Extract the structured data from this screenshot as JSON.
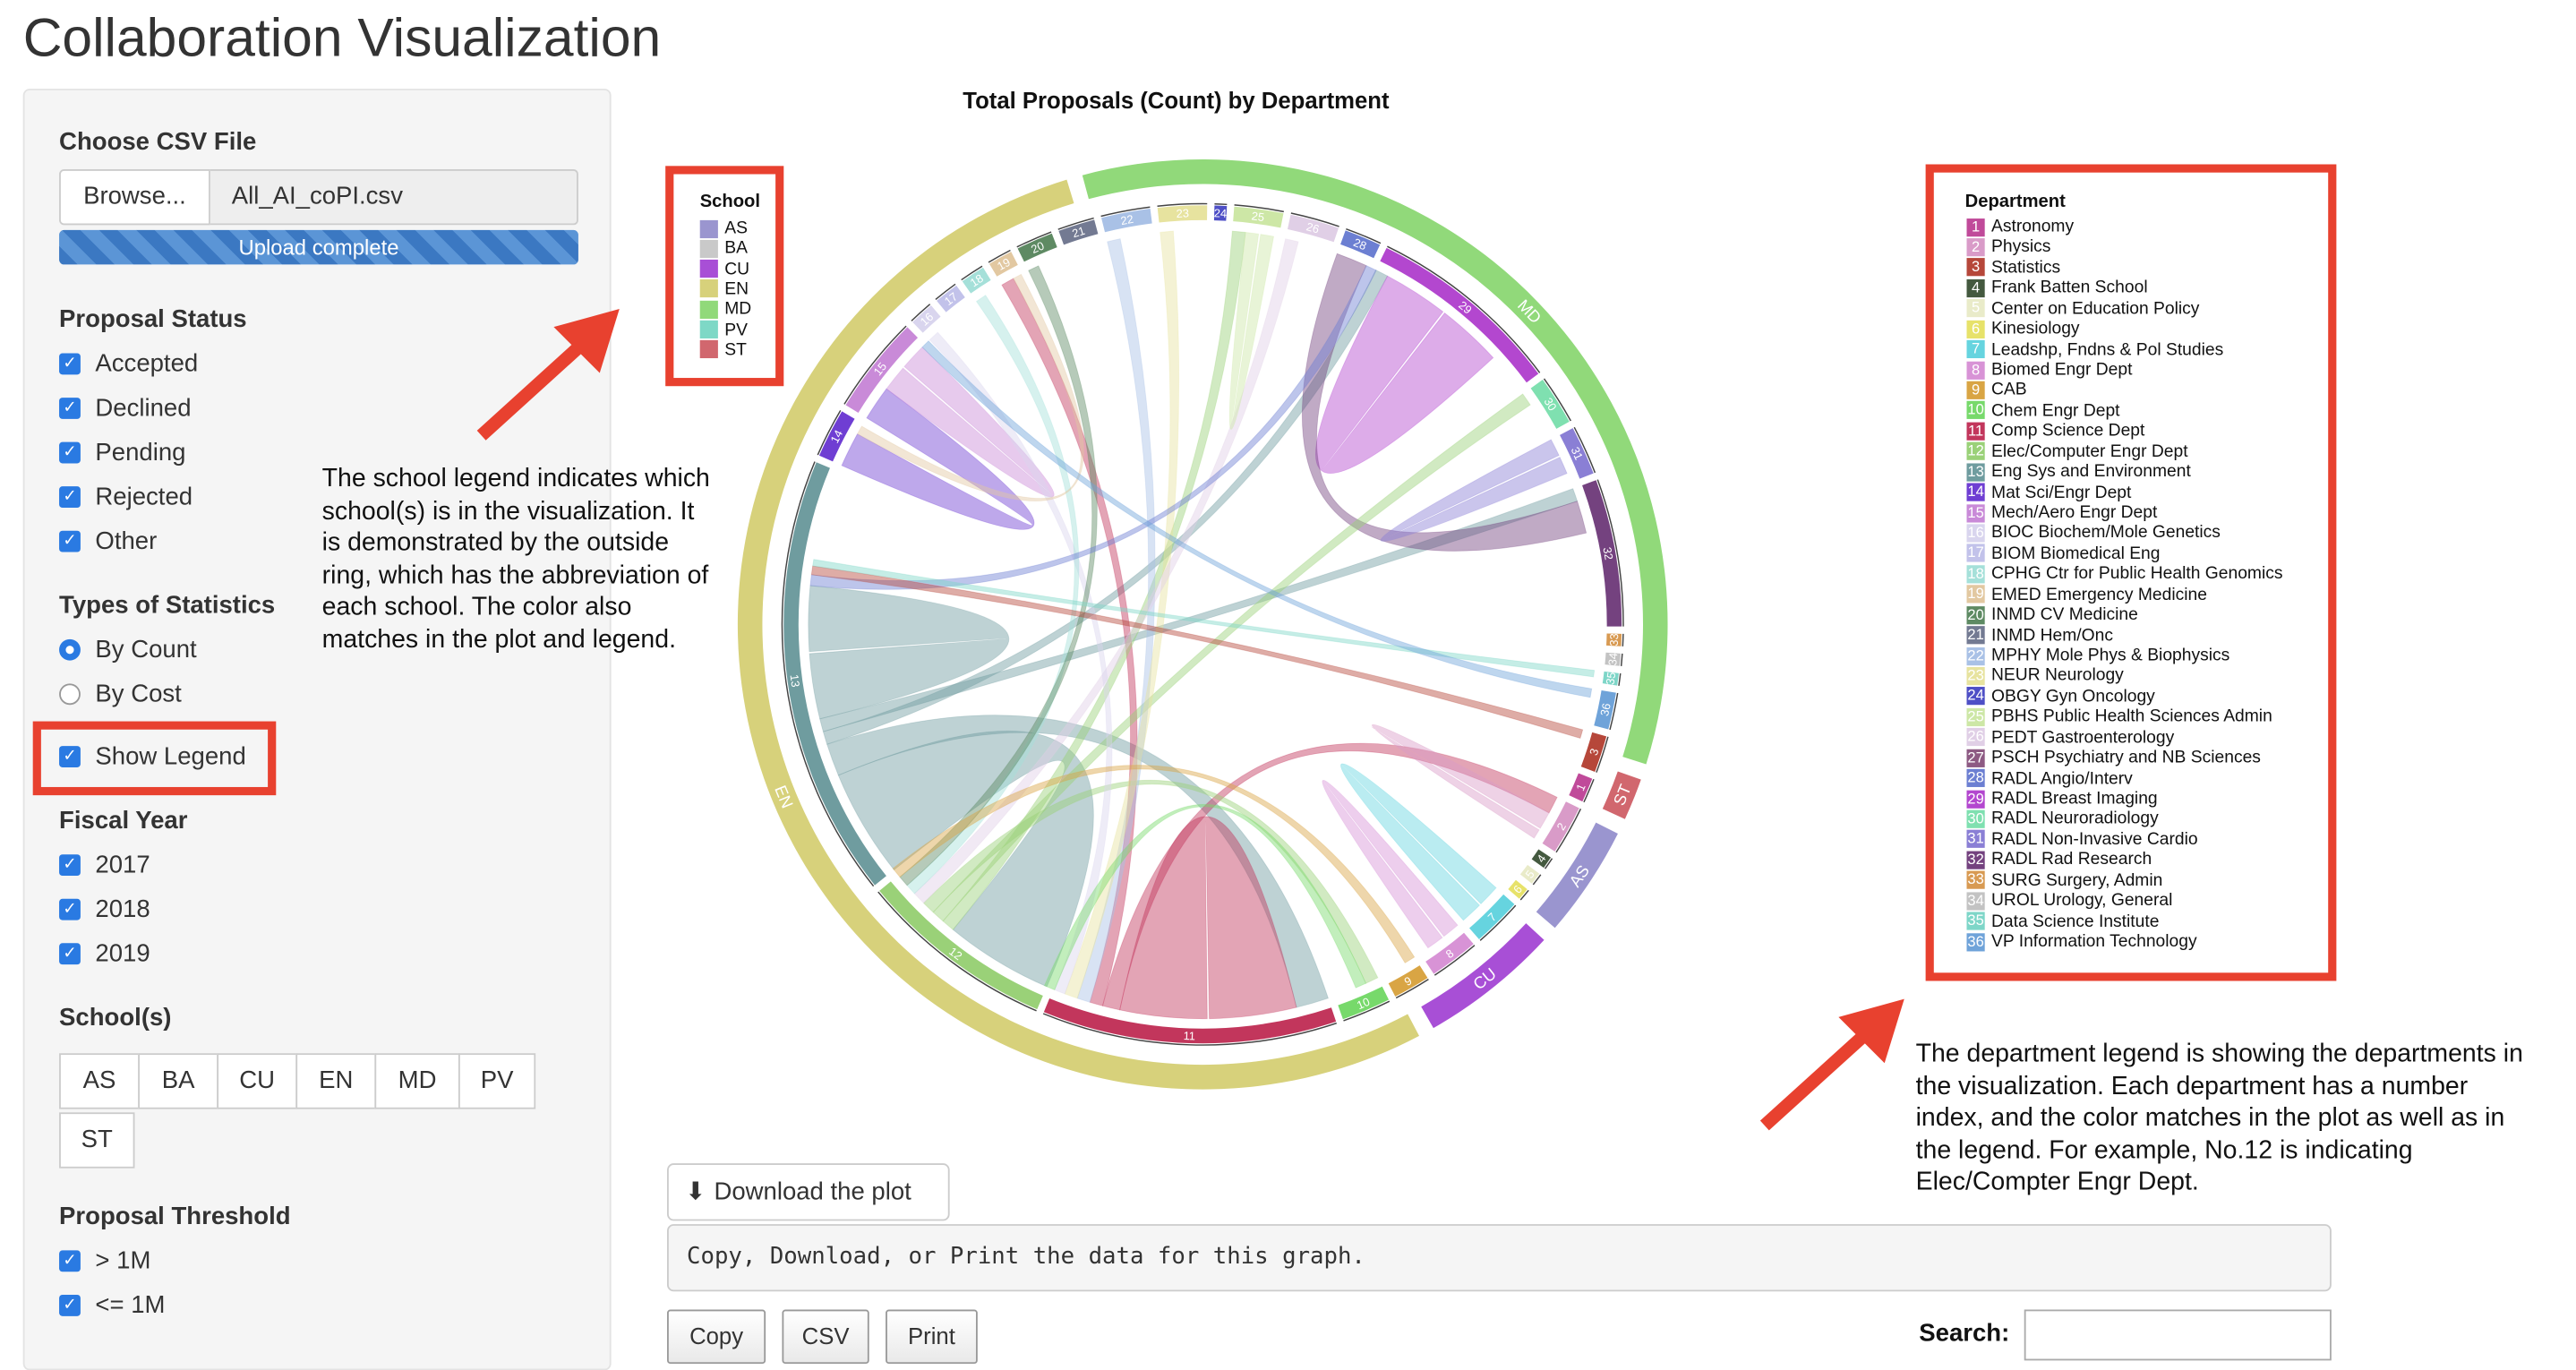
{
  "app": {
    "title": "Collaboration Visualization"
  },
  "sidebar": {
    "csv": {
      "label": "Choose CSV File",
      "browse": "Browse...",
      "file_name": "All_AI_coPI.csv",
      "progress": "Upload complete",
      "progress_pct": 100
    },
    "proposal_status": {
      "label": "Proposal Status",
      "options": [
        {
          "label": "Accepted",
          "checked": true
        },
        {
          "label": "Declined",
          "checked": true
        },
        {
          "label": "Pending",
          "checked": true
        },
        {
          "label": "Rejected",
          "checked": true
        },
        {
          "label": "Other",
          "checked": true
        }
      ]
    },
    "stat_types": {
      "label": "Types of Statistics",
      "options": [
        {
          "label": "By Count",
          "selected": true
        },
        {
          "label": "By Cost",
          "selected": false
        }
      ]
    },
    "show_legend": {
      "label": "Show Legend",
      "checked": true
    },
    "fiscal_year": {
      "label": "Fiscal Year",
      "options": [
        {
          "label": "2017",
          "checked": true
        },
        {
          "label": "2018",
          "checked": true
        },
        {
          "label": "2019",
          "checked": true
        }
      ]
    },
    "schools": {
      "label": "School(s)",
      "buttons": [
        "AS",
        "BA",
        "CU",
        "EN",
        "MD",
        "PV",
        "ST"
      ]
    },
    "threshold": {
      "label": "Proposal Threshold",
      "options": [
        {
          "label": "> 1M",
          "checked": true
        },
        {
          "label": "<= 1M",
          "checked": true
        }
      ]
    }
  },
  "chart_data": {
    "type": "chord",
    "title": "Total Proposals (Count) by Department",
    "school_legend": {
      "title": "School",
      "items": [
        {
          "code": "AS",
          "color": "#9a95cf"
        },
        {
          "code": "BA",
          "color": "#c9c9c9"
        },
        {
          "code": "CU",
          "color": "#a84fd6"
        },
        {
          "code": "EN",
          "color": "#d7d17b"
        },
        {
          "code": "MD",
          "color": "#91d97a"
        },
        {
          "code": "PV",
          "color": "#7ed8c6"
        },
        {
          "code": "ST",
          "color": "#d1676e"
        }
      ]
    },
    "department_legend": {
      "title": "Department",
      "items": [
        {
          "index": "1",
          "name": "Astronomy",
          "color": "#c04a9a"
        },
        {
          "index": "2",
          "name": "Physics",
          "color": "#d99bc8"
        },
        {
          "index": "3",
          "name": "Statistics",
          "color": "#b6473a"
        },
        {
          "index": "4",
          "name": "Frank Batten School",
          "color": "#44593f"
        },
        {
          "index": "5",
          "name": "Center on Education Policy",
          "color": "#e9ebc9"
        },
        {
          "index": "6",
          "name": "Kinesiology",
          "color": "#e7e26a"
        },
        {
          "index": "7",
          "name": "Leadshp, Fndns & Pol Studies",
          "color": "#66d4df"
        },
        {
          "index": "8",
          "name": "Biomed Engr Dept",
          "color": "#d893d6"
        },
        {
          "index": "9",
          "name": "CAB",
          "color": "#d9a544"
        },
        {
          "index": "10",
          "name": "Chem Engr Dept",
          "color": "#77d96b"
        },
        {
          "index": "11",
          "name": "Comp Science Dept",
          "color": "#c2365c"
        },
        {
          "index": "12",
          "name": "Elec/Computer Engr Dept",
          "color": "#9ad178"
        },
        {
          "index": "13",
          "name": "Eng Sys and Environment",
          "color": "#6f9c9f"
        },
        {
          "index": "14",
          "name": "Mat Sci/Engr Dept",
          "color": "#6f3ed3"
        },
        {
          "index": "15",
          "name": "Mech/Aero Engr Dept",
          "color": "#c98ad8"
        },
        {
          "index": "16",
          "name": "BIOC Biochem/Mole Genetics",
          "color": "#d9d5ee"
        },
        {
          "index": "17",
          "name": "BIOM Biomedical Eng",
          "color": "#c2c2ea"
        },
        {
          "index": "18",
          "name": "CPHG Ctr for Public Health Genomics",
          "color": "#a5e0d9"
        },
        {
          "index": "19",
          "name": "EMED Emergency Medicine",
          "color": "#e2c8a1"
        },
        {
          "index": "20",
          "name": "INMD CV Medicine",
          "color": "#5e8a63"
        },
        {
          "index": "21",
          "name": "INMD Hem/Onc",
          "color": "#737a92"
        },
        {
          "index": "22",
          "name": "MPHY Mole Phys & Biophysics",
          "color": "#a9c1e6"
        },
        {
          "index": "23",
          "name": "NEUR Neurology",
          "color": "#e7e39f"
        },
        {
          "index": "24",
          "name": "OBGY Gyn Oncology",
          "color": "#4e4fc6"
        },
        {
          "index": "25",
          "name": "PBHS Public Health Sciences Admin",
          "color": "#cde7a6"
        },
        {
          "index": "26",
          "name": "PEDT Gastroenterology",
          "color": "#e0cfe6"
        },
        {
          "index": "27",
          "name": "PSCH Psychiatry and NB Sciences",
          "color": "#8d5a83"
        },
        {
          "index": "28",
          "name": "RADL Angio/Interv",
          "color": "#6c7fd2"
        },
        {
          "index": "29",
          "name": "RADL Breast Imaging",
          "color": "#b347cf"
        },
        {
          "index": "30",
          "name": "RADL Neuroradiology",
          "color": "#7fe0b0"
        },
        {
          "index": "31",
          "name": "RADL Non-Invasive Cardio",
          "color": "#8a7fd5"
        },
        {
          "index": "32",
          "name": "RADL Rad Research",
          "color": "#74427f"
        },
        {
          "index": "33",
          "name": "SURG Surgery, Admin",
          "color": "#d89a52"
        },
        {
          "index": "34",
          "name": "UROL Urology, General",
          "color": "#c3c3c3"
        },
        {
          "index": "35",
          "name": "Data Science Institute",
          "color": "#7ed6c8"
        },
        {
          "index": "36",
          "name": "VP Information Technology",
          "color": "#6fa3d9"
        }
      ]
    },
    "outer_ring": [
      {
        "school": "MD",
        "color": "#91d97a",
        "value": 35
      },
      {
        "school": "ST",
        "color": "#d1676e",
        "value": 1.5
      },
      {
        "school": "AS",
        "color": "#9a95cf",
        "value": 4
      },
      {
        "school": "CU",
        "color": "#a84fd6",
        "value": 5
      },
      {
        "school": "EN",
        "color": "#d7d17b",
        "value": 54.5
      }
    ],
    "departments": [
      {
        "index": "22",
        "color": "#a9c1e6",
        "value": 2
      },
      {
        "index": "23",
        "color": "#e7e39f",
        "value": 2
      },
      {
        "index": "24",
        "color": "#4e4fc6",
        "value": 0.5
      },
      {
        "index": "25",
        "color": "#cde7a6",
        "value": 2
      },
      {
        "index": "26",
        "color": "#e0cfe6",
        "value": 2
      },
      {
        "index": "28",
        "color": "#6c7fd2",
        "value": 1.5
      },
      {
        "index": "29",
        "color": "#b347cf",
        "value": 8
      },
      {
        "index": "30",
        "color": "#7fe0b0",
        "value": 2
      },
      {
        "index": "31",
        "color": "#8a7fd5",
        "value": 2
      },
      {
        "index": "32",
        "color": "#74427f",
        "value": 6
      },
      {
        "index": "33",
        "color": "#d89a52",
        "value": 0.5
      },
      {
        "index": "34",
        "color": "#c3c3c3",
        "value": 0.5
      },
      {
        "index": "35",
        "color": "#7ed6c8",
        "value": 0.5
      },
      {
        "index": "36",
        "color": "#6fa3d9",
        "value": 1.5
      },
      {
        "index": "3",
        "color": "#b6473a",
        "value": 1.5
      },
      {
        "index": "1",
        "color": "#c04a9a",
        "value": 1
      },
      {
        "index": "2",
        "color": "#d99bc8",
        "value": 2
      },
      {
        "index": "4",
        "color": "#44593f",
        "value": 0.5
      },
      {
        "index": "5",
        "color": "#e9ebc9",
        "value": 0.5
      },
      {
        "index": "6",
        "color": "#e7e26a",
        "value": 0.5
      },
      {
        "index": "7",
        "color": "#66d4df",
        "value": 2
      },
      {
        "index": "8",
        "color": "#d893d6",
        "value": 2
      },
      {
        "index": "9",
        "color": "#d9a544",
        "value": 1.5
      },
      {
        "index": "10",
        "color": "#77d96b",
        "value": 2
      },
      {
        "index": "11",
        "color": "#c2365c",
        "value": 12
      },
      {
        "index": "12",
        "color": "#9ad178",
        "value": 8
      },
      {
        "index": "13",
        "color": "#6f9c9f",
        "value": 18
      },
      {
        "index": "14",
        "color": "#6f3ed3",
        "value": 2
      },
      {
        "index": "15",
        "color": "#c98ad8",
        "value": 4
      },
      {
        "index": "16",
        "color": "#d9d5ee",
        "value": 1
      },
      {
        "index": "17",
        "color": "#c2c2ea",
        "value": 1
      },
      {
        "index": "18",
        "color": "#a5e0d9",
        "value": 1
      },
      {
        "index": "19",
        "color": "#e2c8a1",
        "value": 1
      },
      {
        "index": "20",
        "color": "#5e8a63",
        "value": 1.5
      },
      {
        "index": "21",
        "color": "#737a92",
        "value": 1.5
      }
    ],
    "chords": [
      {
        "from": "13",
        "to": "12",
        "color": "#6f9c9f",
        "w": 5
      },
      {
        "from": "13",
        "to": "11",
        "color": "#6f9c9f",
        "w": 1.5
      },
      {
        "from": "13",
        "to": "29",
        "color": "#6f9c9f",
        "w": 0.6
      },
      {
        "from": "13",
        "to": "32",
        "color": "#6f9c9f",
        "w": 0.6
      },
      {
        "from": "13",
        "to": "13",
        "color": "#6f9c9f",
        "w": 3
      },
      {
        "from": "11",
        "to": "11",
        "color": "#c2365c",
        "w": 4
      },
      {
        "from": "11",
        "to": "2",
        "color": "#c2365c",
        "w": 0.8
      },
      {
        "from": "11",
        "to": "19",
        "color": "#c2365c",
        "w": 0.6
      },
      {
        "from": "14",
        "to": "15",
        "color": "#6f3ed3",
        "w": 1.6
      },
      {
        "from": "29",
        "to": "29",
        "color": "#b347cf",
        "w": 3
      },
      {
        "from": "32",
        "to": "28",
        "color": "#74427f",
        "w": 1.5
      },
      {
        "from": "12",
        "to": "25",
        "color": "#9ad178",
        "w": 0.6
      },
      {
        "from": "12",
        "to": "30",
        "color": "#9ad178",
        "w": 0.6
      },
      {
        "from": "12",
        "to": "10",
        "color": "#9ad178",
        "w": 0.6
      },
      {
        "from": "15",
        "to": "15",
        "color": "#c98ad8",
        "w": 1.2
      },
      {
        "from": "7",
        "to": "7",
        "color": "#66d4df",
        "w": 1
      },
      {
        "from": "8",
        "to": "8",
        "color": "#d893d6",
        "w": 0.8
      },
      {
        "from": "22",
        "to": "11",
        "color": "#a9c1e6",
        "w": 0.6
      },
      {
        "from": "23",
        "to": "11",
        "color": "#e7e39f",
        "w": 0.6
      },
      {
        "from": "26",
        "to": "12",
        "color": "#e0cfe6",
        "w": 0.6
      },
      {
        "from": "2",
        "to": "2",
        "color": "#d99bc8",
        "w": 0.8
      },
      {
        "from": "16",
        "to": "11",
        "color": "#d9d5ee",
        "w": 0.5
      },
      {
        "from": "18",
        "to": "12",
        "color": "#a5e0d9",
        "w": 0.5
      },
      {
        "from": "20",
        "to": "12",
        "color": "#5e8a63",
        "w": 0.5
      },
      {
        "from": "31",
        "to": "31",
        "color": "#8a7fd5",
        "w": 0.8
      },
      {
        "from": "28",
        "to": "13",
        "color": "#6c7fd2",
        "w": 0.5
      },
      {
        "from": "3",
        "to": "13",
        "color": "#b6473a",
        "w": 0.4
      },
      {
        "from": "9",
        "to": "12",
        "color": "#d9a544",
        "w": 0.5
      },
      {
        "from": "10",
        "to": "11",
        "color": "#77d96b",
        "w": 0.5
      },
      {
        "from": "19",
        "to": "14",
        "color": "#e2c8a1",
        "w": 0.4
      },
      {
        "from": "25",
        "to": "25",
        "color": "#cde7a6",
        "w": 0.6
      },
      {
        "from": "35",
        "to": "13",
        "color": "#7ed6c8",
        "w": 0.3
      },
      {
        "from": "36",
        "to": "15",
        "color": "#6fa3d9",
        "w": 0.4
      }
    ]
  },
  "annotations": {
    "school": "The school legend indicates which school(s) is in the visualization. It is demonstrated by the outside ring, which has the abbreviation of each school. The color also matches in the plot and legend.",
    "department": "The department legend is showing the departments in the visualization. Each department has a number index, and the color matches in the plot as well as in the legend. For example, No.12 is indicating Elec/Compter Engr Dept."
  },
  "bottom": {
    "download_label": "Download the plot",
    "copy_hint": "Copy, Download, or Print the data for this graph.",
    "buttons": [
      "Copy",
      "CSV",
      "Print"
    ],
    "search_label": "Search:",
    "search_value": ""
  }
}
